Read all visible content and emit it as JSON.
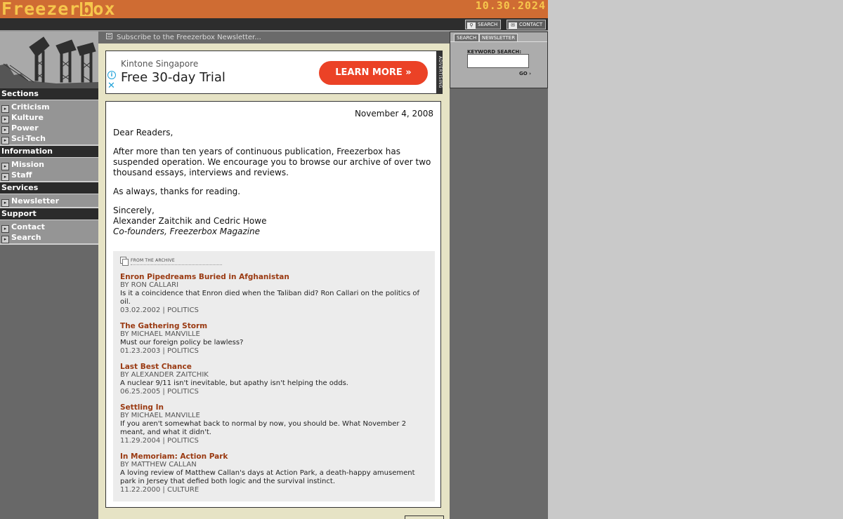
{
  "header": {
    "logo": "Freezerbox",
    "date": "10.30.2024"
  },
  "toplinks": [
    {
      "label": "Search"
    },
    {
      "label": "Contact"
    }
  ],
  "subscribe": "Subscribe to the Freezerbox Newsletter...",
  "nav": {
    "sections_head": "Sections",
    "sections": [
      "Criticism",
      "Kulture",
      "Power",
      "Sci-Tech"
    ],
    "information_head": "Information",
    "information": [
      "Mission",
      "Staff"
    ],
    "services_head": "Services",
    "services": [
      "Newsletter"
    ],
    "support_head": "Support",
    "support": [
      "Contact",
      "Search"
    ]
  },
  "ad": {
    "sponsor": "Kintone Singapore",
    "headline": "Free 30-day Trial",
    "button": "LEARN MORE  »",
    "tag": "ADVERTISING"
  },
  "letter": {
    "date": "November 4, 2008",
    "greeting": "Dear Readers,",
    "body1": "After more than ten years of continuous publication, Freezerbox has suspended operation. We encourage you to browse our archive of over two thousand essays, interviews and reviews.",
    "body2": "As always, thanks for reading.",
    "closing": "Sincerely,",
    "names": "Alexander Zaitchik and Cedric Howe",
    "role": "Co-founders, Freezerbox Magazine"
  },
  "archive": {
    "label": "From the Archive",
    "items": [
      {
        "title": "Enron Pipedreams Buried in Afghanistan",
        "byline": "BY RON CALLARI",
        "desc": "Is it a coincidence that Enron died when the Taliban did? Ron Callari on the politics of oil.",
        "meta": "03.02.2002 | POLITICS"
      },
      {
        "title": "The Gathering Storm",
        "byline": "BY MICHAEL MANVILLE",
        "desc": "Must our foreign policy be lawless?",
        "meta": "01.23.2003 | POLITICS"
      },
      {
        "title": "Last Best Chance",
        "byline": "BY ALEXANDER ZAITCHIK",
        "desc": "A nuclear 9/11 isn't inevitable, but apathy isn't helping the odds.",
        "meta": "06.25.2005 | POLITICS"
      },
      {
        "title": "Settling In",
        "byline": "BY MICHAEL MANVILLE",
        "desc": "If you aren't somewhat back to normal by now, you should be. What November 2 meant, and what it didn't.",
        "meta": "11.29.2004 | POLITICS"
      },
      {
        "title": "In Memoriam: Action Park",
        "byline": "BY MATTHEW CALLAN",
        "desc": "A loving review of Matthew Callan's days at Action Park, a death-happy amusement park in Jersey that defied both logic and the survival instinct.",
        "meta": "11.22.2000 | CULTURE"
      }
    ]
  },
  "search_panel": {
    "tabs": [
      "Search",
      "Newsletter"
    ],
    "keyword_label": "Keyword Search:",
    "go": "GO"
  }
}
